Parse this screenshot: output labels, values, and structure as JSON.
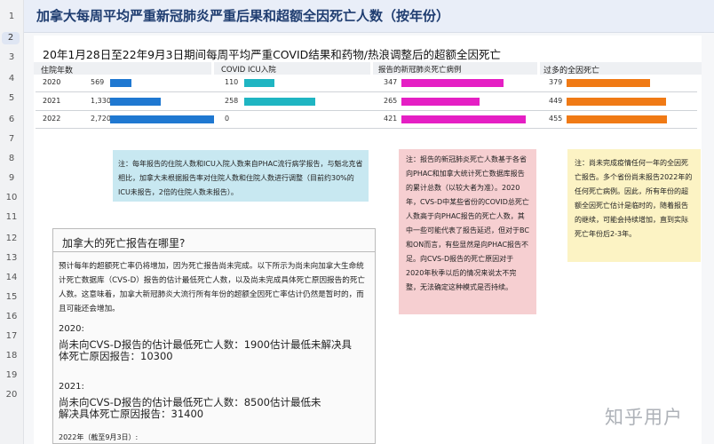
{
  "window": {
    "title": "加拿大每周平均严重新冠肺炎严重后果和超额全因死亡人数（按年份）"
  },
  "gutter": {
    "line_numbers": [
      "1",
      "2",
      "3",
      "4",
      "5",
      "6",
      "7",
      "8",
      "9",
      "10",
      "11",
      "12",
      "13",
      "14",
      "15",
      "16",
      "17",
      "18",
      "19",
      "20"
    ],
    "selected": "2"
  },
  "chart": {
    "subtitle": "20年1月28日至22年9月3日期间每周平均严重COVID结果和药物/热浪调整后的超额全因死亡",
    "headers": [
      "住院年数",
      "COVID ICU入院",
      "报告的新冠肺炎死亡病例",
      "过多的全因死亡"
    ],
    "rows": [
      {
        "year": "2020",
        "hosp": "569",
        "icu": "110",
        "deaths": "347",
        "excess": "379"
      },
      {
        "year": "2021",
        "hosp": "1,330",
        "icu": "258",
        "deaths": "265",
        "excess": "449"
      },
      {
        "year": "2022",
        "hosp": "2,720",
        "icu": "0",
        "deaths": "421",
        "excess": "455"
      }
    ],
    "colors": {
      "hosp": "#1f78d1",
      "icu": "#1fb5c2",
      "deaths": "#e51fc4",
      "excess": "#f07a15"
    }
  },
  "chart_data": [
    {
      "type": "bar",
      "ylabel": "住院年数",
      "categories": [
        "2020",
        "2021",
        "2022"
      ],
      "values": [
        569,
        1330,
        2720
      ]
    },
    {
      "type": "bar",
      "ylabel": "COVID ICU入院",
      "categories": [
        "2020",
        "2021",
        "2022"
      ],
      "values": [
        110,
        258,
        0
      ]
    },
    {
      "type": "bar",
      "ylabel": "报告的新冠肺炎死亡病例",
      "categories": [
        "2020",
        "2021",
        "2022"
      ],
      "values": [
        347,
        265,
        421
      ]
    },
    {
      "type": "bar",
      "ylabel": "过多的全因死亡",
      "categories": [
        "2020",
        "2021",
        "2022"
      ],
      "values": [
        379,
        449,
        455
      ]
    }
  ],
  "notes": {
    "blue": "注：每年报告的住院人数和ICU入院人数来自PHAC流行病学报告，与魁北克省相比，加拿大未根据报告率对住院人数和住院人数进行调整（目前约30%的ICU未报告，2倍的住院人数未报告）。",
    "pink": "注：报告的新冠肺炎死亡人数基于各省向PHAC和加拿大统计死亡数据库报告的累计总数（以较大者为准）。2020年，CVS-D中某些省份的COVID总死亡人数高于向PHAC报告的死亡人数，其中一些可能代表了报告延迟，但对于BC和ON而言，有些显然是向PHAC报告不足。向CVS-D报告的死亡原因对于2020年秋季以后的情况来说太不完整，无法确定这种模式是否持续。",
    "yellow": "注：尚未完成疫情任何一年的全因死亡报告。多个省份尚未报告2022年的任何死亡病例。因此，所有年份的超额全因死亡估计是临时的，随着报告的继续，可能会持续增加，直到实际死亡年份后2-3年。"
  },
  "box": {
    "title": "加拿大的死亡报告在哪里?",
    "para": "预计每年的超额死亡率仍将增加，因为死亡报告尚未完成。以下所示为尚未向加拿大生命统计死亡数据库（CVS-D）报告的估计最低死亡人数，以及尚未完成具体死亡原因报告的死亡人数。这意味着，加拿大新冠肺炎大流行所有年份的超额全因死亡率估计仍然是暂时的，而且可能还会增加。",
    "y2020_label": "2020:",
    "y2020_text": "尚未向CVS-D报告的估计最低死亡人数：1900估计最低未解决具体死亡原因报告：10300",
    "y2021_label": "2021:",
    "y2021_text": "尚未向CVS-D报告的估计最低死亡人数：8500估计最低未解决具体死亡原因报告：31400",
    "y2022_label": "2022年（截至9月3日）:"
  },
  "watermark": "知乎用户"
}
